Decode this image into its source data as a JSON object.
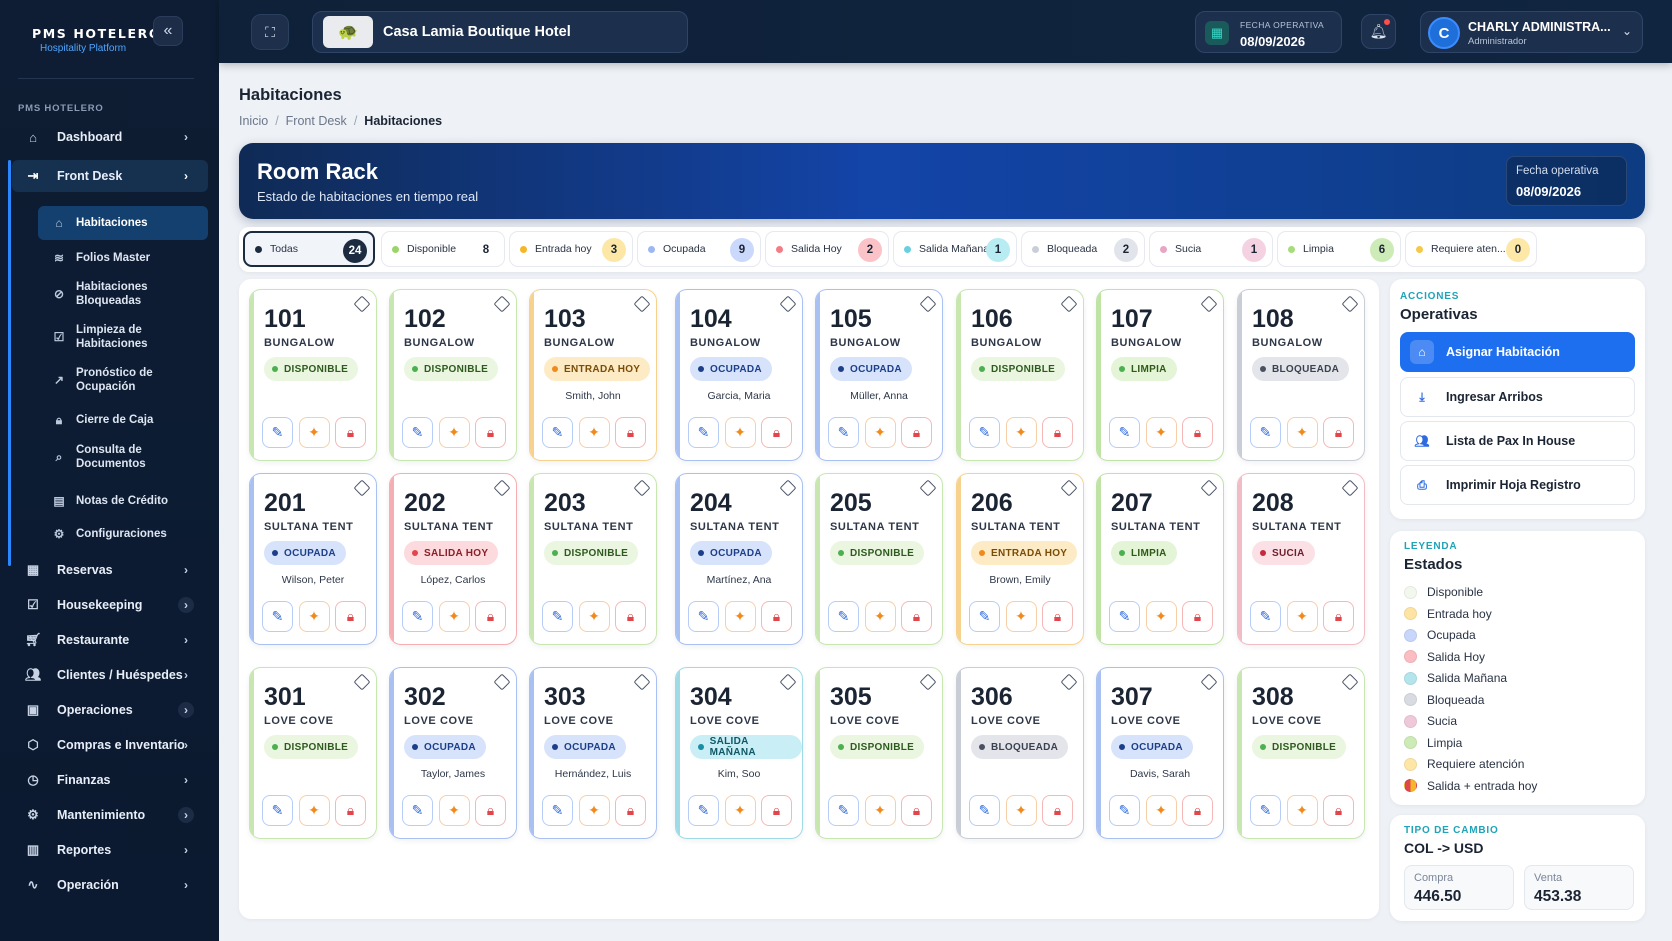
{
  "sidebar": {
    "brand_title": "PMS HOTELERO",
    "brand_sub": "Hospitality Platform",
    "section": "PMS HOTELERO",
    "collapse_icon": "double-chevron-left-icon",
    "items": [
      {
        "label": "Dashboard",
        "icon": "home-icon"
      },
      {
        "label": "Front Desk",
        "icon": "login-icon"
      },
      {
        "label": "Reservas",
        "icon": "calendar-icon"
      },
      {
        "label": "Housekeeping",
        "icon": "clipboard-check-icon"
      },
      {
        "label": "Restaurante",
        "icon": "cart-icon"
      },
      {
        "label": "Clientes / Huéspedes",
        "icon": "users-icon"
      },
      {
        "label": "Operaciones",
        "icon": "briefcase-icon"
      },
      {
        "label": "Compras e Inventario",
        "icon": "box-icon"
      },
      {
        "label": "Finanzas",
        "icon": "clock-icon"
      },
      {
        "label": "Mantenimiento",
        "icon": "gear-icon"
      },
      {
        "label": "Reportes",
        "icon": "bar-chart-icon"
      },
      {
        "label": "Operación",
        "icon": "pulse-icon"
      }
    ],
    "subitems": [
      {
        "label": "Habitaciones",
        "icon": "home-icon"
      },
      {
        "label": "Folios Master",
        "icon": "layers-icon"
      },
      {
        "label": "Habitaciones Bloqueadas",
        "icon": "ban-icon"
      },
      {
        "label": "Limpieza de Habitaciones",
        "icon": "check-square-icon"
      },
      {
        "label": "Pronóstico de Ocupación",
        "icon": "trend-icon"
      },
      {
        "label": "Cierre de Caja",
        "icon": "lock-icon"
      },
      {
        "label": "Consulta de Documentos",
        "icon": "search-icon"
      },
      {
        "label": "Notas de Crédito",
        "icon": "document-icon"
      },
      {
        "label": "Configuraciones",
        "icon": "gear-icon"
      }
    ]
  },
  "topbar": {
    "hotel": "Casa Lamia Boutique Hotel",
    "fecha_label": "FECHA OPERATIVA",
    "fecha_value": "08/09/2026",
    "user_initial": "C",
    "user_name": "CHARLY ADMINISTRA...",
    "user_role": "Administrador"
  },
  "page": {
    "title": "Habitaciones",
    "crumbs": [
      "Inicio",
      "Front Desk",
      "Habitaciones"
    ]
  },
  "banner": {
    "title": "Room Rack",
    "subtitle": "Estado de habitaciones en tiempo real",
    "date_label": "Fecha operativa",
    "date_value": "08/09/2026"
  },
  "filters": [
    {
      "label": "Todas",
      "count": "24",
      "dot": "#1d2b40",
      "cntbg": "#1d2b40",
      "cntfg": "#ffffff"
    },
    {
      "label": "Disponible",
      "count": "8",
      "dot": "#9bd46a",
      "cntbg": "#ffffff",
      "cntfg": "#1b2433"
    },
    {
      "label": "Entrada hoy",
      "count": "3",
      "dot": "#f5b72a",
      "cntbg": "#fde7a6",
      "cntfg": "#1b2433"
    },
    {
      "label": "Ocupada",
      "count": "9",
      "dot": "#9db7f2",
      "cntbg": "#c9d8fb",
      "cntfg": "#1b2433"
    },
    {
      "label": "Salida Hoy",
      "count": "2",
      "dot": "#f47c85",
      "cntbg": "#fbc3c8",
      "cntfg": "#1b2433"
    },
    {
      "label": "Salida Mañana",
      "count": "1",
      "dot": "#6ccfe0",
      "cntbg": "#b7ecf3",
      "cntfg": "#1b2433"
    },
    {
      "label": "Bloqueada",
      "count": "2",
      "dot": "#c9ced8",
      "cntbg": "#e1e4ea",
      "cntfg": "#1b2433"
    },
    {
      "label": "Sucia",
      "count": "1",
      "dot": "#e6a7c4",
      "cntbg": "#f5d2e2",
      "cntfg": "#1b2433"
    },
    {
      "label": "Limpia",
      "count": "6",
      "dot": "#a6dc7b",
      "cntbg": "#cdebb6",
      "cntfg": "#1b2433"
    },
    {
      "label": "Requiere aten...",
      "count": "0",
      "dot": "#f5c84a",
      "cntbg": "#fde8a8",
      "cntfg": "#1b2433"
    }
  ],
  "status_styles": {
    "DISPONIBLE": {
      "bg": "#eaf6e0",
      "fg": "#2e5a1f",
      "dot": "#4caf50",
      "border": "#c7e6b0"
    },
    "ENTRADA HOY": {
      "bg": "#fdebc6",
      "fg": "#7a4c05",
      "dot": "#f08a1c",
      "border": "#f7d28f"
    },
    "OCUPADA": {
      "bg": "#d7e3fb",
      "fg": "#1d3f8a",
      "dot": "#1d3f8a",
      "border": "#a9c0f2"
    },
    "SALIDA HOY": {
      "bg": "#fddadd",
      "fg": "#8a1f28",
      "dot": "#e0464b",
      "border": "#f4aeb4"
    },
    "SALIDA MAÑANA": {
      "bg": "#c9eef5",
      "fg": "#0f5967",
      "dot": "#1a8ea3",
      "border": "#9fdbe6"
    },
    "BLOQUEADA": {
      "bg": "#e3e5ea",
      "fg": "#3a4150",
      "dot": "#4a5160",
      "border": "#c9cdd6"
    },
    "SUCIA": {
      "bg": "#fbe1e6",
      "fg": "#6e1d2c",
      "dot": "#c6283f",
      "border": "#f2bcc6"
    },
    "LIMPIA": {
      "bg": "#e3f4d7",
      "fg": "#2f5a17",
      "dot": "#4caf50",
      "border": "#bfe3a4"
    }
  },
  "rooms": [
    {
      "num": "101",
      "type": "BUNGALOW",
      "status": "DISPONIBLE",
      "guest": ""
    },
    {
      "num": "102",
      "type": "BUNGALOW",
      "status": "DISPONIBLE",
      "guest": ""
    },
    {
      "num": "103",
      "type": "BUNGALOW",
      "status": "ENTRADA HOY",
      "guest": "Smith, John"
    },
    {
      "num": "104",
      "type": "BUNGALOW",
      "status": "OCUPADA",
      "guest": "Garcia, Maria"
    },
    {
      "num": "105",
      "type": "BUNGALOW",
      "status": "OCUPADA",
      "guest": "Müller, Anna"
    },
    {
      "num": "106",
      "type": "BUNGALOW",
      "status": "DISPONIBLE",
      "guest": ""
    },
    {
      "num": "107",
      "type": "BUNGALOW",
      "status": "LIMPIA",
      "guest": ""
    },
    {
      "num": "108",
      "type": "BUNGALOW",
      "status": "BLOQUEADA",
      "guest": ""
    },
    {
      "num": "201",
      "type": "SULTANA TENT",
      "status": "OCUPADA",
      "guest": "Wilson, Peter"
    },
    {
      "num": "202",
      "type": "SULTANA TENT",
      "status": "SALIDA HOY",
      "guest": "López, Carlos"
    },
    {
      "num": "203",
      "type": "SULTANA TENT",
      "status": "DISPONIBLE",
      "guest": ""
    },
    {
      "num": "204",
      "type": "SULTANA TENT",
      "status": "OCUPADA",
      "guest": "Martínez, Ana"
    },
    {
      "num": "205",
      "type": "SULTANA TENT",
      "status": "DISPONIBLE",
      "guest": ""
    },
    {
      "num": "206",
      "type": "SULTANA TENT",
      "status": "ENTRADA HOY",
      "guest": "Brown, Emily"
    },
    {
      "num": "207",
      "type": "SULTANA TENT",
      "status": "LIMPIA",
      "guest": ""
    },
    {
      "num": "208",
      "type": "SULTANA TENT",
      "status": "SUCIA",
      "guest": ""
    },
    {
      "num": "301",
      "type": "LOVE COVE",
      "status": "DISPONIBLE",
      "guest": ""
    },
    {
      "num": "302",
      "type": "LOVE COVE",
      "status": "OCUPADA",
      "guest": "Taylor, James"
    },
    {
      "num": "303",
      "type": "LOVE COVE",
      "status": "OCUPADA",
      "guest": "Hernández, Luis"
    },
    {
      "num": "304",
      "type": "LOVE COVE",
      "status": "SALIDA MAÑANA",
      "guest": "Kim, Soo"
    },
    {
      "num": "305",
      "type": "LOVE COVE",
      "status": "DISPONIBLE",
      "guest": ""
    },
    {
      "num": "306",
      "type": "LOVE COVE",
      "status": "BLOQUEADA",
      "guest": ""
    },
    {
      "num": "307",
      "type": "LOVE COVE",
      "status": "OCUPADA",
      "guest": "Davis, Sarah"
    },
    {
      "num": "308",
      "type": "LOVE COVE",
      "status": "DISPONIBLE",
      "guest": ""
    }
  ],
  "room_action_icons": [
    "pencil-icon",
    "sparkle-icon",
    "lock-icon"
  ],
  "acciones": {
    "kicker": "ACCIONES",
    "title": "Operativas",
    "buttons": [
      {
        "label": "Asignar Habitación",
        "icon": "home-icon"
      },
      {
        "label": "Ingresar Arribos",
        "icon": "download-icon"
      },
      {
        "label": "Lista de Pax In House",
        "icon": "users-icon"
      },
      {
        "label": "Imprimir Hoja Registro",
        "icon": "printer-icon"
      }
    ]
  },
  "leyenda": {
    "kicker": "LEYENDA",
    "title": "Estados",
    "items": [
      {
        "label": "Disponible",
        "color": "#f3f8ee"
      },
      {
        "label": "Entrada hoy",
        "color": "#fde4a2"
      },
      {
        "label": "Ocupada",
        "color": "#c7d6fa"
      },
      {
        "label": "Salida Hoy",
        "color": "#fbbcc2"
      },
      {
        "label": "Salida Mañana",
        "color": "#b4e4ec"
      },
      {
        "label": "Bloqueada",
        "color": "#d8dbe2"
      },
      {
        "label": "Sucia",
        "color": "#efc9d9"
      },
      {
        "label": "Limpia",
        "color": "#cdebb6"
      },
      {
        "label": "Requiere atención",
        "color": "#fde6a6"
      },
      {
        "label": "Salida + entrada hoy",
        "color": "split"
      }
    ]
  },
  "tipo_cambio": {
    "kicker": "TIPO DE CAMBIO",
    "title": "COL -> USD",
    "compra_label": "Compra",
    "compra_value": "446.50",
    "venta_label": "Venta",
    "venta_value": "453.38"
  }
}
